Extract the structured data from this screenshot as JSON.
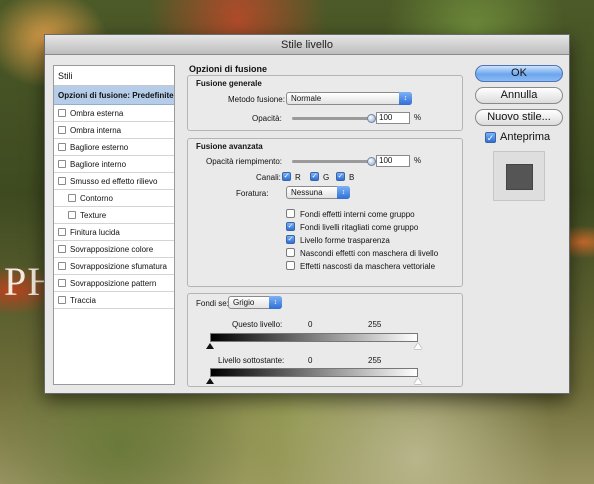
{
  "background": {
    "text": "PH"
  },
  "window": {
    "title": "Stile livello"
  },
  "sidebar": {
    "header": "Stili",
    "items": [
      {
        "label": "Opzioni di fusione: Predefinite",
        "selected": true,
        "checkbox": false
      },
      {
        "label": "Ombra esterna",
        "checkbox": true,
        "checked": false
      },
      {
        "label": "Ombra interna",
        "checkbox": true,
        "checked": false
      },
      {
        "label": "Bagliore esterno",
        "checkbox": true,
        "checked": false
      },
      {
        "label": "Bagliore interno",
        "checkbox": true,
        "checked": false
      },
      {
        "label": "Smusso ed effetto rilievo",
        "checkbox": true,
        "checked": false
      },
      {
        "label": "Contorno",
        "checkbox": true,
        "checked": false,
        "indent": true
      },
      {
        "label": "Texture",
        "checkbox": true,
        "checked": false,
        "indent": true
      },
      {
        "label": "Finitura lucida",
        "checkbox": true,
        "checked": false
      },
      {
        "label": "Sovrapposizione colore",
        "checkbox": true,
        "checked": false
      },
      {
        "label": "Sovrapposizione sfumatura",
        "checkbox": true,
        "checked": false
      },
      {
        "label": "Sovrapposizione pattern",
        "checkbox": true,
        "checked": false
      },
      {
        "label": "Traccia",
        "checkbox": true,
        "checked": false
      }
    ]
  },
  "main": {
    "section_title": "Opzioni di fusione",
    "general": {
      "title": "Fusione generale",
      "mode_label": "Metodo fusione:",
      "mode_value": "Normale",
      "opacity_label": "Opacità:",
      "opacity_value": "100",
      "opacity_unit": "%",
      "opacity_level": 1.0
    },
    "advanced": {
      "title": "Fusione avanzata",
      "fill_label": "Opacità riempimento:",
      "fill_value": "100",
      "fill_unit": "%",
      "fill_level": 1.0,
      "channels_label": "Canali:",
      "channels": [
        {
          "label": "R",
          "checked": true
        },
        {
          "label": "G",
          "checked": true
        },
        {
          "label": "B",
          "checked": true
        }
      ],
      "knockout_label": "Foratura:",
      "knockout_value": "Nessuna",
      "options": [
        {
          "label": "Fondi effetti interni come gruppo",
          "checked": false
        },
        {
          "label": "Fondi livelli ritagliati come gruppo",
          "checked": true
        },
        {
          "label": "Livello forme trasparenza",
          "checked": true
        },
        {
          "label": "Nascondi effetti con maschera di livello",
          "checked": false
        },
        {
          "label": "Effetti nascosti da maschera vettoriale",
          "checked": false
        }
      ]
    },
    "blend_if": {
      "label": "Fondi se:",
      "value": "Grigio",
      "this_layer_label": "Questo livello:",
      "this_layer_min": "0",
      "this_layer_max": "255",
      "underlying_label": "Livello sottostante:",
      "underlying_min": "0",
      "underlying_max": "255"
    }
  },
  "buttons": {
    "ok": "OK",
    "cancel": "Annulla",
    "new_style": "Nuovo stile...",
    "preview_label": "Anteprima",
    "preview_checked": true
  },
  "colors": {
    "selection": "#b6cde9",
    "accent_blue": "#2f6fd7",
    "window_bg": "#e8e8e8"
  }
}
